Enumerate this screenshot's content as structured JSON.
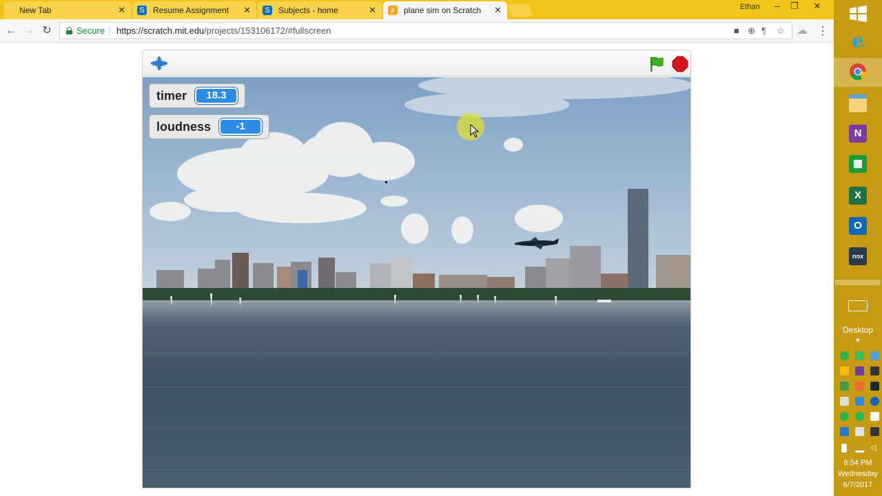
{
  "browser": {
    "tabs": [
      {
        "label": "New Tab",
        "active": false,
        "icon": "none"
      },
      {
        "label": "Resume Assignment",
        "active": false,
        "icon": "sharepoint-icon"
      },
      {
        "label": "Subjects - home",
        "active": false,
        "icon": "sharepoint-icon"
      },
      {
        "label": "plane sim on Scratch",
        "active": true,
        "icon": "scratch-icon"
      }
    ],
    "profile_name": "Ethan",
    "secure_label": "Secure",
    "url_host": "https://scratch.mit.edu",
    "url_path": "/projects/153106172/#fullscreen"
  },
  "scratch": {
    "monitors": [
      {
        "label": "timer",
        "value": "18.3"
      },
      {
        "label": "loudness",
        "value": "-1"
      }
    ]
  },
  "taskbar": {
    "apps": [
      "internet-explorer-icon",
      "chrome-icon",
      "file-explorer-icon",
      "onenote-icon",
      "store-icon",
      "excel-icon",
      "outlook-icon",
      "nox-icon"
    ],
    "desktop_label": "Desktop",
    "clock": {
      "time": "8:54 PM",
      "day": "Wednesday",
      "date": "6/7/2017"
    }
  },
  "colors": {
    "tab_strip": "#f0c419",
    "taskbar": "#c79a14",
    "monitor_value": "#2d8ce8",
    "secure": "#1a8a34"
  }
}
